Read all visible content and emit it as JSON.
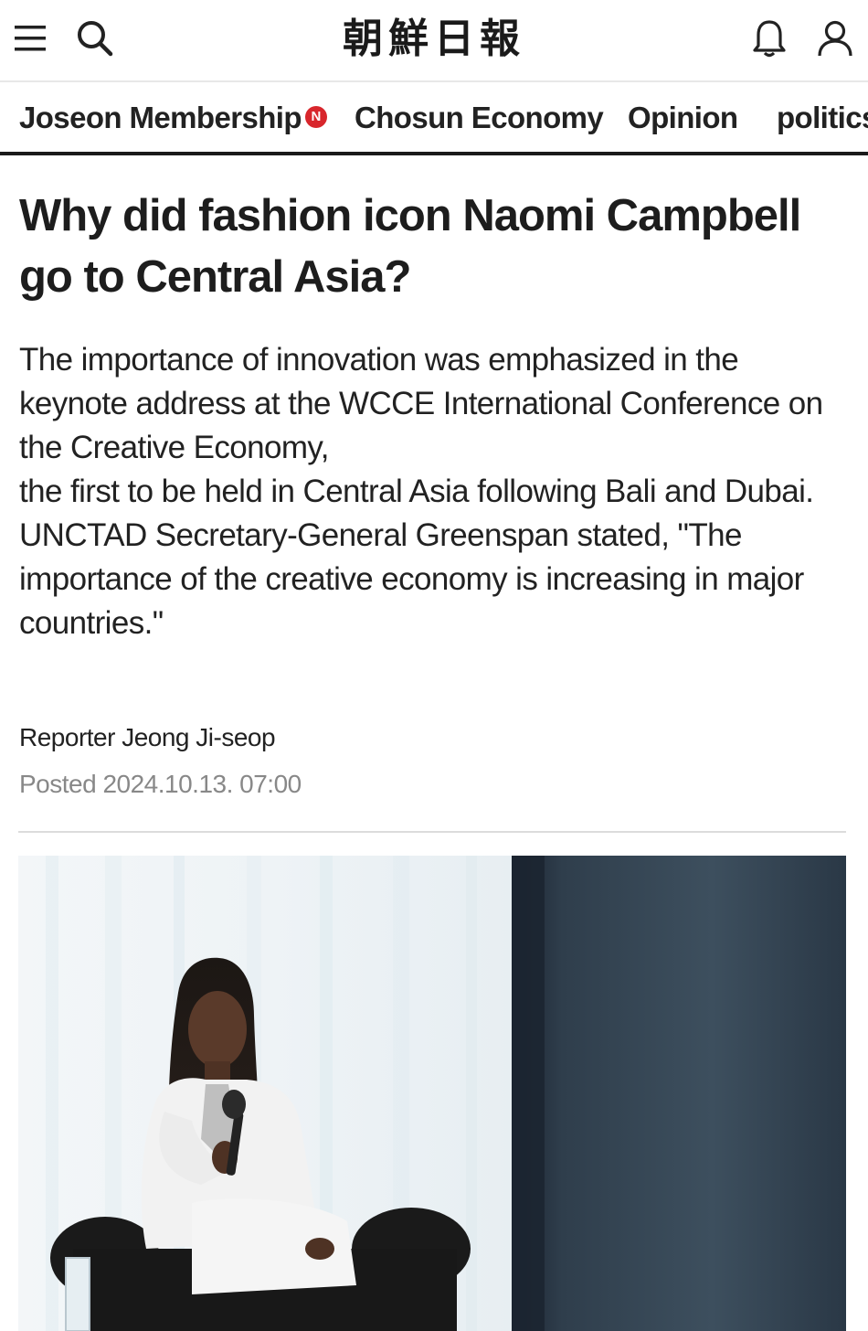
{
  "header": {
    "logo_text": "朝鮮日報",
    "icons": [
      "menu-icon",
      "search-icon",
      "bell-icon",
      "user-icon"
    ]
  },
  "nav": {
    "items": [
      {
        "label": "Joseon Membership",
        "badge": "N"
      },
      {
        "label": "Chosun Economy"
      },
      {
        "label": "Opinion"
      },
      {
        "label": "politics"
      }
    ]
  },
  "article": {
    "headline": "Why did fashion icon Naomi Campbell go to Central Asia?",
    "subhead_lines": [
      "The importance of innovation was emphasized in the keynote address at the WCCE International Conference on the Creative Economy,",
      "the first to be held in Central Asia following Bali and Dubai.",
      "UNCTAD Secretary-General Greenspan stated, \"The importance of the creative economy is increasing in major countries.\""
    ],
    "byline": "Reporter Jeong Ji-seop",
    "posted": "Posted 2024.10.13. 07:00"
  },
  "colors": {
    "accent_red": "#d8262c",
    "nav_underline": "#1a1a1a",
    "date_gray": "#888888"
  }
}
